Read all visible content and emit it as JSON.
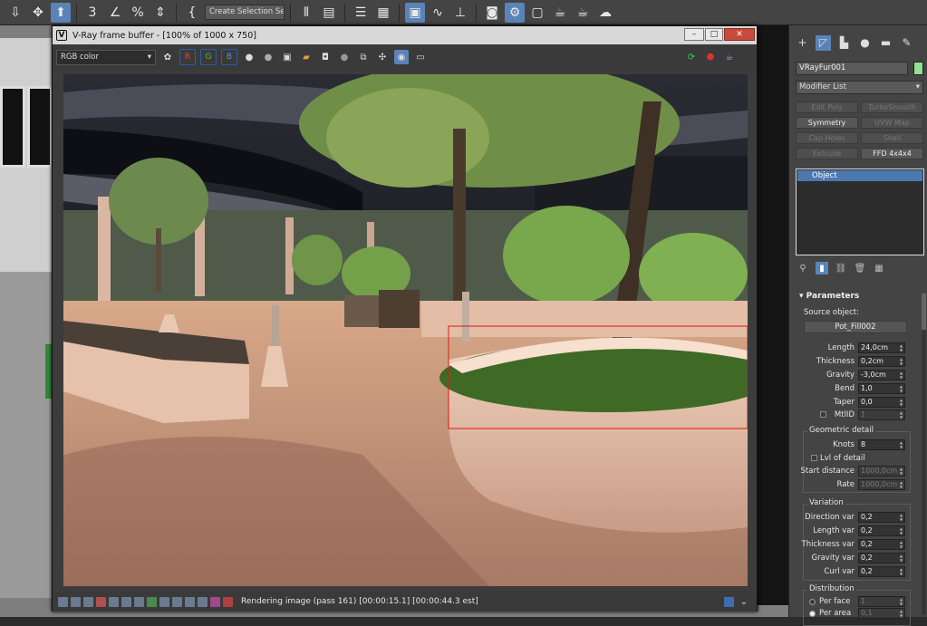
{
  "toolbar": {
    "selection_set_placeholder": "Create Selection Se"
  },
  "frame_buffer": {
    "title": "V-Ray frame buffer - [100% of 1000 x 750]",
    "channel": "RGB color",
    "rgb_buttons": [
      "R",
      "G",
      "B"
    ],
    "status": "Rendering image (pass 161) [00:00:15.1] [00:00:44.3 est]"
  },
  "command_panel": {
    "object_name": "VRayFur001",
    "object_color": "#8fe08f",
    "modifier_list": "Modifier List",
    "modifier_buttons": [
      {
        "label": "Edit Poly",
        "enabled": false
      },
      {
        "label": "TurboSmooth",
        "enabled": false
      },
      {
        "label": "Symmetry",
        "enabled": true
      },
      {
        "label": "UVW Map",
        "enabled": false
      },
      {
        "label": "Cap Holes",
        "enabled": false
      },
      {
        "label": "Shell",
        "enabled": false
      },
      {
        "label": "Extrude",
        "enabled": false
      },
      {
        "label": "FFD 4x4x4",
        "enabled": true
      }
    ],
    "stack_item": "Object",
    "rollout": "Parameters",
    "source_object_label": "Source object:",
    "source_object": "Pot_Fill002",
    "params": [
      {
        "label": "Length",
        "value": "24,0cm"
      },
      {
        "label": "Thickness",
        "value": "0,2cm"
      },
      {
        "label": "Gravity",
        "value": "-3,0cm"
      },
      {
        "label": "Bend",
        "value": "1,0"
      },
      {
        "label": "Taper",
        "value": "0,0"
      },
      {
        "label": "MtlID",
        "value": "1"
      }
    ],
    "geometric_detail": {
      "title": "Geometric detail",
      "knots_label": "Knots",
      "knots": "8",
      "lvl_of_detail": "Lvl of detail",
      "start_distance_label": "Start distance",
      "start_distance": "1000,0cm",
      "rate_label": "Rate",
      "rate": "1000,0cm"
    },
    "variation": {
      "title": "Variation",
      "items": [
        {
          "label": "Direction var",
          "value": "0,2"
        },
        {
          "label": "Length var",
          "value": "0,2"
        },
        {
          "label": "Thickness var",
          "value": "0,2"
        },
        {
          "label": "Gravity var",
          "value": "0,2"
        },
        {
          "label": "Curl var",
          "value": "0,2"
        }
      ]
    },
    "distribution": {
      "title": "Distribution",
      "per_face_label": "Per face",
      "per_face": "1",
      "per_area_label": "Per area",
      "per_area": "0,1"
    }
  }
}
